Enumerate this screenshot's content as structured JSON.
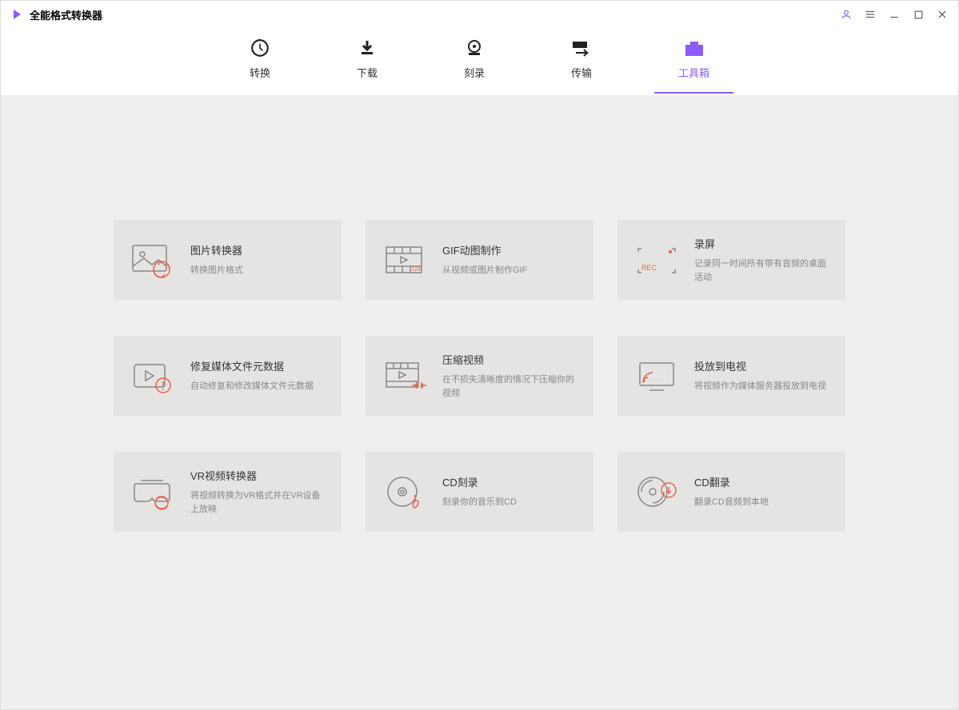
{
  "app_title": "全能格式转换器",
  "tabs": [
    {
      "label": "转换"
    },
    {
      "label": "下载"
    },
    {
      "label": "刻录"
    },
    {
      "label": "传输"
    },
    {
      "label": "工具箱"
    }
  ],
  "tools": [
    {
      "title": "图片转换器",
      "desc": "转换图片格式"
    },
    {
      "title": "GIF动图制作",
      "desc": "从视频或图片制作GIF"
    },
    {
      "title": "录屏",
      "desc": "记录同一时间所有带有音频的桌面活动"
    },
    {
      "title": "修复媒体文件元数据",
      "desc": "自动修复和修改媒体文件元数据"
    },
    {
      "title": "压缩视频",
      "desc": "在不损失清晰度的情况下压缩你的视频"
    },
    {
      "title": "投放到电视",
      "desc": "将视频作为媒体服务器投放到电视"
    },
    {
      "title": "VR视频转换器",
      "desc": "将视频转换为VR格式并在VR设备上放映"
    },
    {
      "title": "CD刻录",
      "desc": "刻录你的音乐到CD"
    },
    {
      "title": "CD翻录",
      "desc": "翻录CD音频到本地"
    }
  ]
}
